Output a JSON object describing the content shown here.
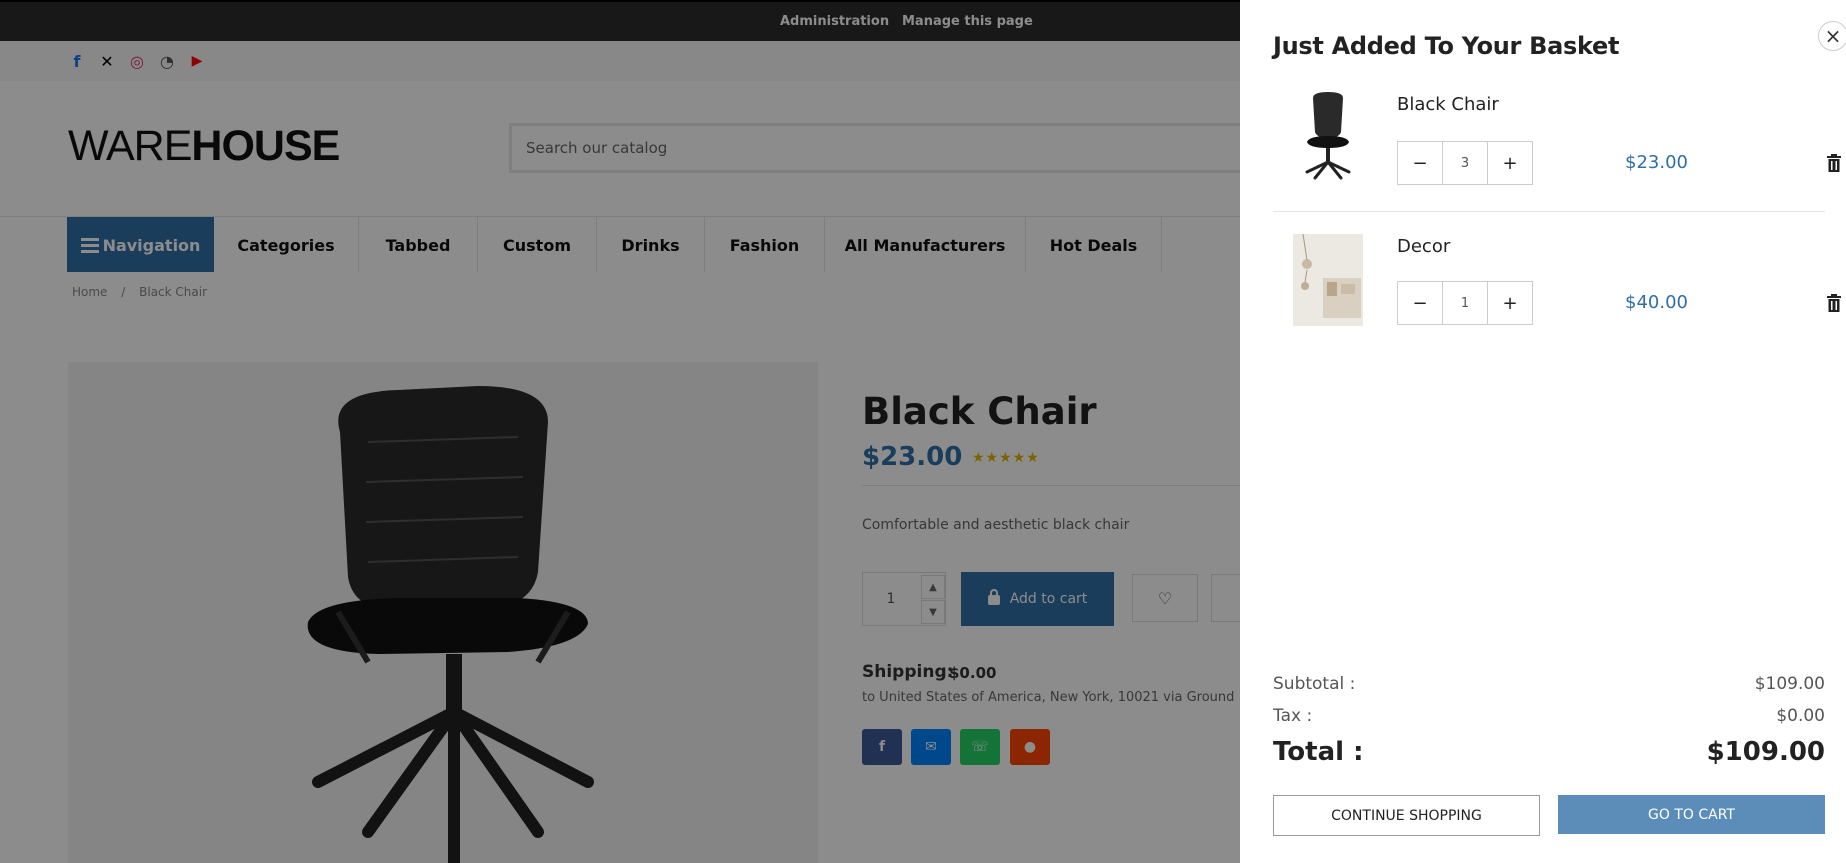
{
  "admin_bar": {
    "administration": "Administration",
    "manage_page": "Manage this page"
  },
  "social": [
    {
      "name": "facebook-icon",
      "glyph": "f",
      "color": "#1877f2"
    },
    {
      "name": "x-icon",
      "glyph": "✕",
      "color": "#000000"
    },
    {
      "name": "instagram-icon",
      "glyph": "◎",
      "color": "#e1306c"
    },
    {
      "name": "rss-icon",
      "glyph": "◔",
      "color": "#555555"
    },
    {
      "name": "youtube-icon",
      "glyph": "▶",
      "color": "#ff0000"
    }
  ],
  "logo": {
    "thin": "WARE",
    "bold": "HOUSE"
  },
  "search": {
    "placeholder": "Search our catalog"
  },
  "nav": {
    "main": "Navigation",
    "items": [
      "Categories",
      "Tabbed",
      "Custom",
      "Drinks",
      "Fashion",
      "All Manufacturers",
      "Hot Deals"
    ]
  },
  "breadcrumb": {
    "home": "Home",
    "sep": "/",
    "current": "Black Chair"
  },
  "product": {
    "title": "Black Chair",
    "price": "$23.00",
    "stars": "★★★★★",
    "description": "Comfortable and aesthetic black chair",
    "qty": "1",
    "add_to_cart": "Add to cart",
    "shipping_label": "Shipping:",
    "shipping_value": "$0.00",
    "shipping_note": "to United States of America, New York, 10021 via Ground"
  },
  "share": [
    {
      "name": "share-facebook-icon",
      "glyph": "f",
      "color": "#3b5998"
    },
    {
      "name": "share-messenger-icon",
      "glyph": "✉",
      "color": "#0084ff"
    },
    {
      "name": "share-whatsapp-icon",
      "glyph": "☏",
      "color": "#25d366"
    },
    {
      "name": "share-reddit-icon",
      "glyph": "●",
      "color": "#ff4500"
    }
  ],
  "basket": {
    "title": "Just Added To Your Basket",
    "close": "×",
    "items": [
      {
        "name": "Black Chair",
        "qty": "3",
        "price": "$23.00"
      },
      {
        "name": "Decor",
        "qty": "1",
        "price": "$40.00"
      }
    ],
    "minus": "−",
    "plus": "+",
    "subtotal_label": "Subtotal :",
    "subtotal": "$109.00",
    "tax_label": "Tax :",
    "tax": "$0.00",
    "total_label": "Total :",
    "total": "$109.00",
    "continue": "CONTINUE SHOPPING",
    "go_to_cart": "GO TO CART"
  },
  "colors": {
    "accent": "#2f6fa6",
    "go_button": "#5b8db8",
    "overlay": "rgba(0,0,0,0.45)"
  }
}
